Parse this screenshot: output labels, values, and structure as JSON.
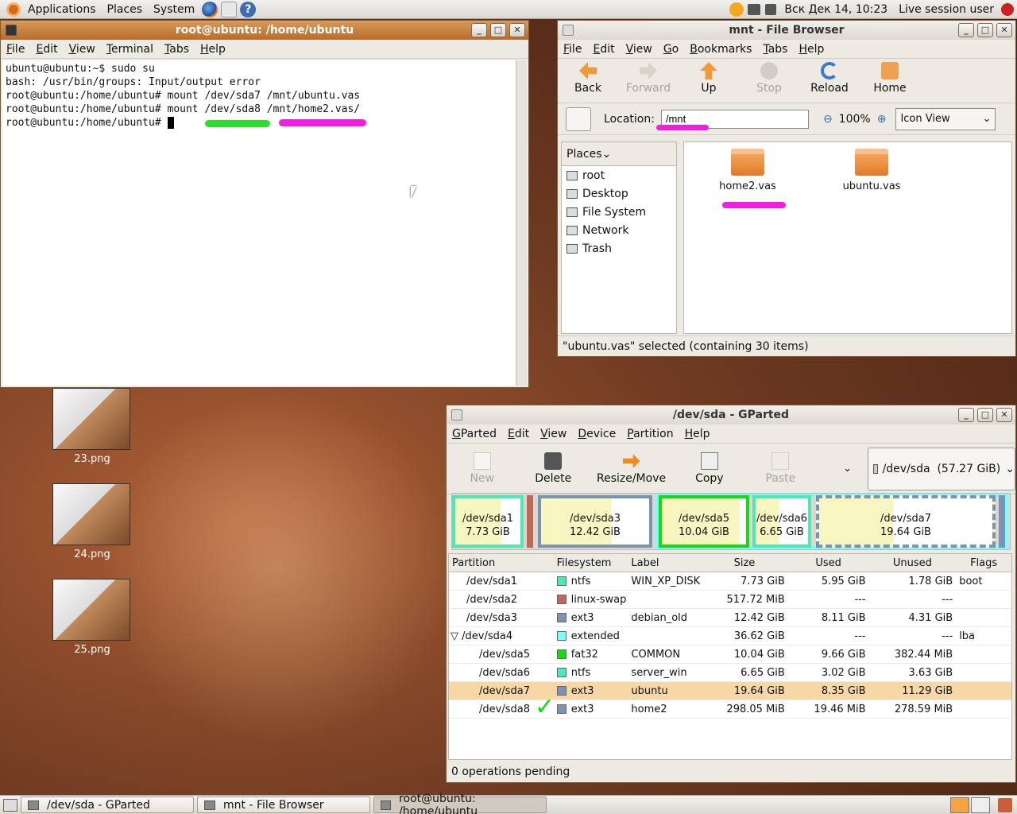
{
  "top_panel": {
    "menus": [
      "Applications",
      "Places",
      "System"
    ],
    "clock": "Вск Дек 14, 10:23",
    "user": "Live session user"
  },
  "terminal": {
    "title": "root@ubuntu: /home/ubuntu",
    "menu": [
      "File",
      "Edit",
      "View",
      "Terminal",
      "Tabs",
      "Help"
    ],
    "lines": [
      "ubuntu@ubuntu:~$ sudo su",
      "bash: /usr/bin/groups: Input/output error",
      "root@ubuntu:/home/ubuntu# mount /dev/sda7 /mnt/ubuntu.vas",
      "root@ubuntu:/home/ubuntu# mount /dev/sda8 /mnt/home2.vas/",
      "root@ubuntu:/home/ubuntu# "
    ]
  },
  "file_browser": {
    "title": "mnt - File Browser",
    "menu": [
      "File",
      "Edit",
      "View",
      "Go",
      "Bookmarks",
      "Tabs",
      "Help"
    ],
    "toolbar": {
      "back": "Back",
      "forward": "Forward",
      "up": "Up",
      "stop": "Stop",
      "reload": "Reload",
      "home": "Home"
    },
    "location_label": "Location:",
    "location": "/mnt",
    "zoom": "100%",
    "view_mode": "Icon View",
    "places_title": "Places",
    "places": [
      "root",
      "Desktop",
      "File System",
      "Network",
      "Trash"
    ],
    "items": [
      "home2.vas",
      "ubuntu.vas"
    ],
    "status": "\"ubuntu.vas\" selected (containing 30 items)"
  },
  "desktop_icons": [
    "23.png",
    "24.png",
    "25.png"
  ],
  "gparted": {
    "title": "/dev/sda - GParted",
    "menu": [
      "GParted",
      "Edit",
      "View",
      "Device",
      "Partition",
      "Help"
    ],
    "toolbar": {
      "new": "New",
      "delete": "Delete",
      "resize": "Resize/Move",
      "copy": "Copy",
      "paste": "Paste"
    },
    "device": "/dev/sda  (57.27 GiB)",
    "map": [
      {
        "name": "/dev/sda1",
        "size": "7.73 GiB"
      },
      {
        "name": "/dev/sda3",
        "size": "12.42 GiB"
      },
      {
        "name": "/dev/sda5",
        "size": "10.04 GiB"
      },
      {
        "name": "/dev/sda6",
        "size": "6.65 GiB"
      },
      {
        "name": "/dev/sda7",
        "size": "19.64 GiB"
      }
    ],
    "columns": [
      "Partition",
      "Filesystem",
      "Label",
      "Size",
      "Used",
      "Unused",
      "Flags"
    ],
    "rows": [
      {
        "partition": "/dev/sda1",
        "fs": "ntfs",
        "color": "#4de8b4",
        "label": "WIN_XP_DISK",
        "size": "7.73 GiB",
        "used": "5.95 GiB",
        "unused": "1.78 GiB",
        "flags": "boot"
      },
      {
        "partition": "/dev/sda2",
        "fs": "linux-swap",
        "color": "#c1665a",
        "label": "",
        "size": "517.72 MiB",
        "used": "---",
        "unused": "---",
        "flags": ""
      },
      {
        "partition": "/dev/sda3",
        "fs": "ext3",
        "color": "#7b94b3",
        "label": "debian_old",
        "size": "12.42 GiB",
        "used": "8.11 GiB",
        "unused": "4.31 GiB",
        "flags": ""
      },
      {
        "partition": "/dev/sda4",
        "fs": "extended",
        "color": "#7dfcfe",
        "label": "",
        "size": "36.62 GiB",
        "used": "---",
        "unused": "---",
        "flags": "lba"
      },
      {
        "partition": "/dev/sda5",
        "fs": "fat32",
        "color": "#18d918",
        "label": "COMMON",
        "size": "10.04 GiB",
        "used": "9.66 GiB",
        "unused": "382.44 MiB",
        "flags": ""
      },
      {
        "partition": "/dev/sda6",
        "fs": "ntfs",
        "color": "#4de8b4",
        "label": "server_win",
        "size": "6.65 GiB",
        "used": "3.02 GiB",
        "unused": "3.63 GiB",
        "flags": ""
      },
      {
        "partition": "/dev/sda7",
        "fs": "ext3",
        "color": "#7b94b3",
        "label": "ubuntu",
        "size": "19.64 GiB",
        "used": "8.35 GiB",
        "unused": "11.29 GiB",
        "flags": ""
      },
      {
        "partition": "/dev/sda8",
        "fs": "ext3",
        "color": "#7b94b3",
        "label": "home2",
        "size": "298.05 MiB",
        "used": "19.46 MiB",
        "unused": "278.59 MiB",
        "flags": ""
      }
    ],
    "status": "0 operations pending"
  },
  "taskbar": [
    "/dev/sda - GParted",
    "mnt - File Browser",
    "root@ubuntu: /home/ubuntu"
  ]
}
